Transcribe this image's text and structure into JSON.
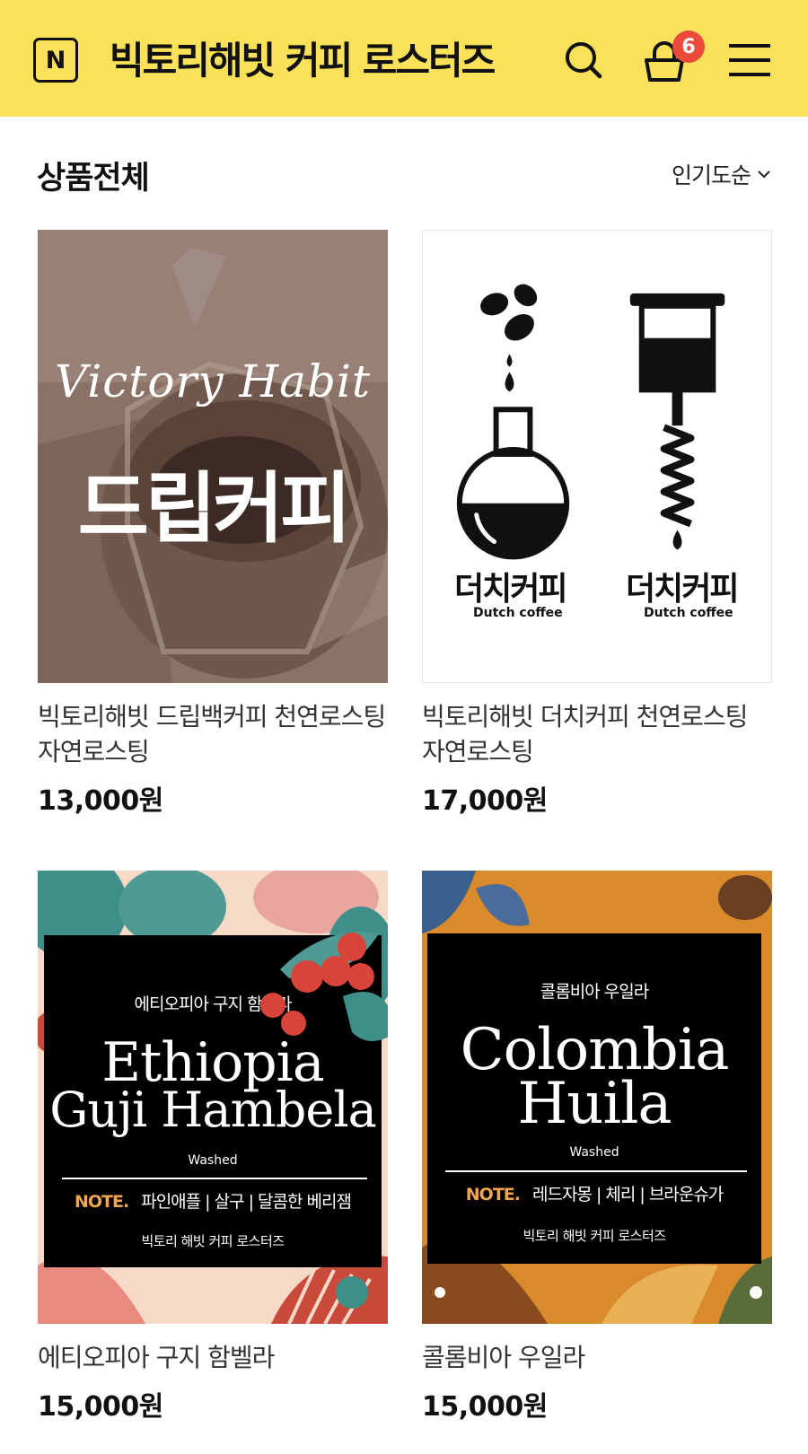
{
  "header": {
    "logo_letter": "N",
    "store_name": "빅토리해빗 커피 로스터즈",
    "cart_count": "6",
    "bg_color": "#f9e15a"
  },
  "listing": {
    "title": "상품전체",
    "sort_label": "인기도순"
  },
  "products": [
    {
      "name": "빅토리해빗 드립백커피 천연로스팅 자연로스팅",
      "price": "13,000원",
      "image": {
        "script_text": "Victory Habit",
        "big_text": "드립커피"
      }
    },
    {
      "name": "빅토리해빗 더치커피 천연로스팅 자연로스팅",
      "price": "17,000원",
      "image": {
        "left_ko": "더치커피",
        "left_en": "Dutch coffee",
        "right_ko": "더치커피",
        "right_en": "Dutch coffee"
      }
    },
    {
      "name": "에티오피아 구지 함벨라",
      "price": "15,000원",
      "image": {
        "ko_title": "에티오피아 구지 함벨라",
        "en_line1": "Ethiopia",
        "en_line2": "Guji Hambela",
        "process": "Washed",
        "note_tag": "NOTE.",
        "notes": "파인애플 | 살구 | 달콤한 베리잼",
        "brand": "빅토리 해빗 커피 로스터즈"
      }
    },
    {
      "name": "콜롬비아 우일라",
      "price": "15,000원",
      "image": {
        "ko_title": "콜롬비아 우일라",
        "en_line1": "Colombia",
        "en_line2": "Huila",
        "process": "Washed",
        "note_tag": "NOTE.",
        "notes": "레드자몽 | 체리 | 브라운슈가",
        "brand": "빅토리 해빗 커피 로스터즈"
      }
    }
  ]
}
